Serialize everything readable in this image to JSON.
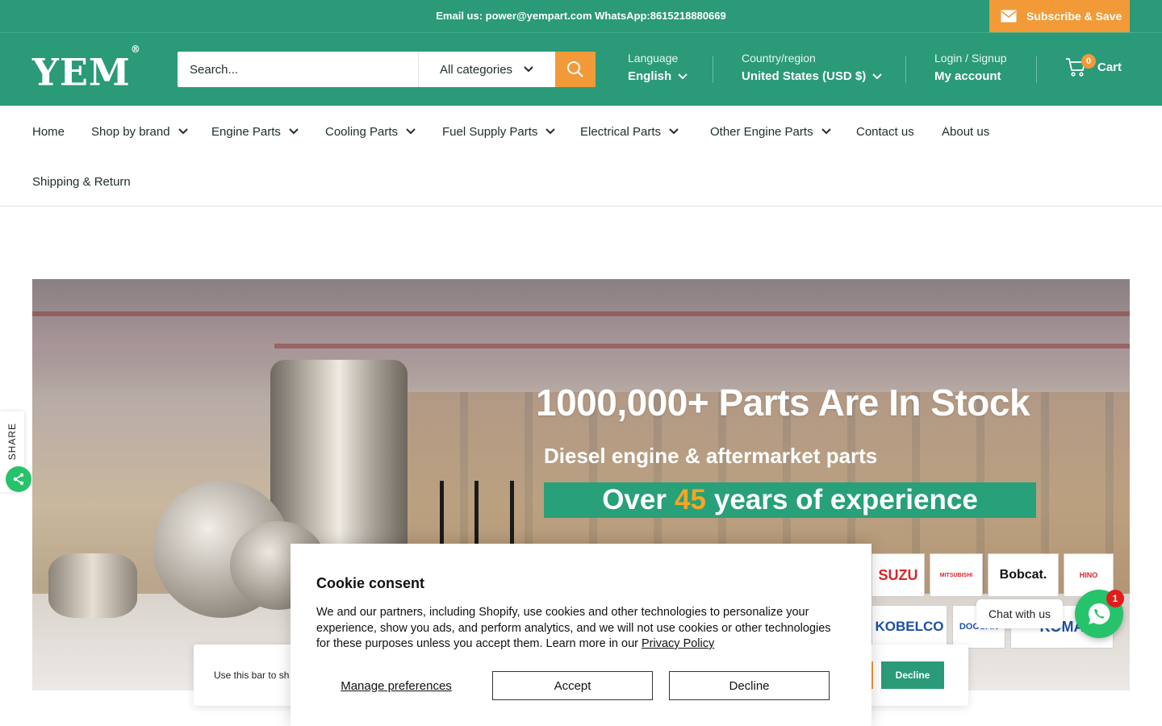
{
  "topbar": {
    "message": "Email us: power@yempart.com WhatsApp:8615218880669",
    "subscribe_label": "Subscribe & Save"
  },
  "header": {
    "logo_text": "YEM",
    "logo_mark": "®",
    "search_placeholder": "Search...",
    "category_label": "All categories",
    "language_label": "Language",
    "language_value": "English",
    "country_label": "Country/region",
    "country_value": "United States (USD $)",
    "login_label": "Login / Signup",
    "account_label": "My account",
    "cart_label": "Cart",
    "cart_count": "0"
  },
  "nav": {
    "items": [
      {
        "label": "Home"
      },
      {
        "label": "Shop by brand"
      },
      {
        "label": "Engine Parts"
      },
      {
        "label": "Cooling Parts"
      },
      {
        "label": "Fuel Supply Parts"
      },
      {
        "label": "Electrical Parts"
      },
      {
        "label": "Other Engine Parts"
      },
      {
        "label": "Contact us"
      },
      {
        "label": "About us"
      },
      {
        "label": "Shipping & Return"
      }
    ]
  },
  "hero": {
    "headline": "1000,000+ Parts Are In Stock",
    "subline": "Diesel engine & aftermarket parts",
    "band_pre": "Over",
    "band_accent": "45",
    "band_post": "years of experience",
    "brands": [
      "SUZU",
      "MITSUBISHI",
      "Bobcat.",
      "HINO",
      "KOBELCO",
      "DOOSAN",
      "KOMA"
    ]
  },
  "share": {
    "label": "SHARE"
  },
  "bottom_bar": {
    "text": "Use this bar to sh",
    "decline_label": "Decline"
  },
  "cookie": {
    "title": "Cookie consent",
    "body": "We and our partners, including Shopify, use cookies and other technologies to personalize your experience, show you ads, and perform analytics, and we will not use cookies or other technologies for these purposes unless you accept them. Learn more in our ",
    "privacy_link": "Privacy Policy",
    "manage_label": "Manage preferences",
    "accept_label": "Accept",
    "decline_label": "Decline"
  },
  "chat": {
    "label": "Chat with us",
    "badge": "1"
  },
  "colors": {
    "brand_green": "#2a9a78",
    "accent_orange": "#f29a38",
    "whatsapp_green": "#27c36a",
    "badge_red": "#e21b1b"
  }
}
